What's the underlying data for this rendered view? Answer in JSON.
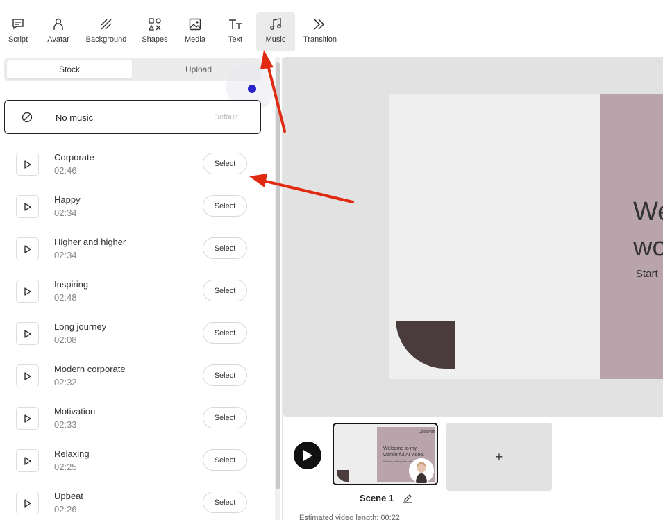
{
  "toolbar": {
    "items": [
      {
        "label": "Script",
        "icon": "script-icon"
      },
      {
        "label": "Avatar",
        "icon": "avatar-icon"
      },
      {
        "label": "Background",
        "icon": "background-icon"
      },
      {
        "label": "Shapes",
        "icon": "shapes-icon"
      },
      {
        "label": "Media",
        "icon": "media-icon"
      },
      {
        "label": "Text",
        "icon": "text-icon"
      },
      {
        "label": "Music",
        "icon": "music-icon",
        "active": true
      },
      {
        "label": "Transition",
        "icon": "transition-icon"
      }
    ]
  },
  "music_panel": {
    "tabs": {
      "stock": "Stock",
      "upload": "Upload"
    },
    "no_music": {
      "label": "No music",
      "badge": "Default"
    },
    "select_label": "Select",
    "tracks": [
      {
        "name": "Corporate",
        "duration": "02:46"
      },
      {
        "name": "Happy",
        "duration": "02:34"
      },
      {
        "name": "Higher and higher",
        "duration": "02:34"
      },
      {
        "name": "Inspiring",
        "duration": "02:48"
      },
      {
        "name": "Long journey",
        "duration": "02:08"
      },
      {
        "name": "Modern corporate",
        "duration": "02:32"
      },
      {
        "name": "Motivation",
        "duration": "02:33"
      },
      {
        "name": "Relaxing",
        "duration": "02:25"
      },
      {
        "name": "Upbeat",
        "duration": "02:26"
      }
    ]
  },
  "canvas": {
    "title": "We\nwo",
    "subtitle": "Start",
    "accent_color": "#b9a4ac",
    "shape_color": "#4a3c3c"
  },
  "timeline": {
    "scene_label": "Scene 1",
    "add_label": "+",
    "estimate": "Estimated video length: 00:22",
    "thumb": {
      "badge": "Colossyan",
      "title": "Welcome to my wonderful AI video.",
      "subtitle": "Start by editing the scene"
    }
  },
  "colors": {
    "annotation_arrow": "#e02a12",
    "indicator_dot": "#2b22c8"
  }
}
